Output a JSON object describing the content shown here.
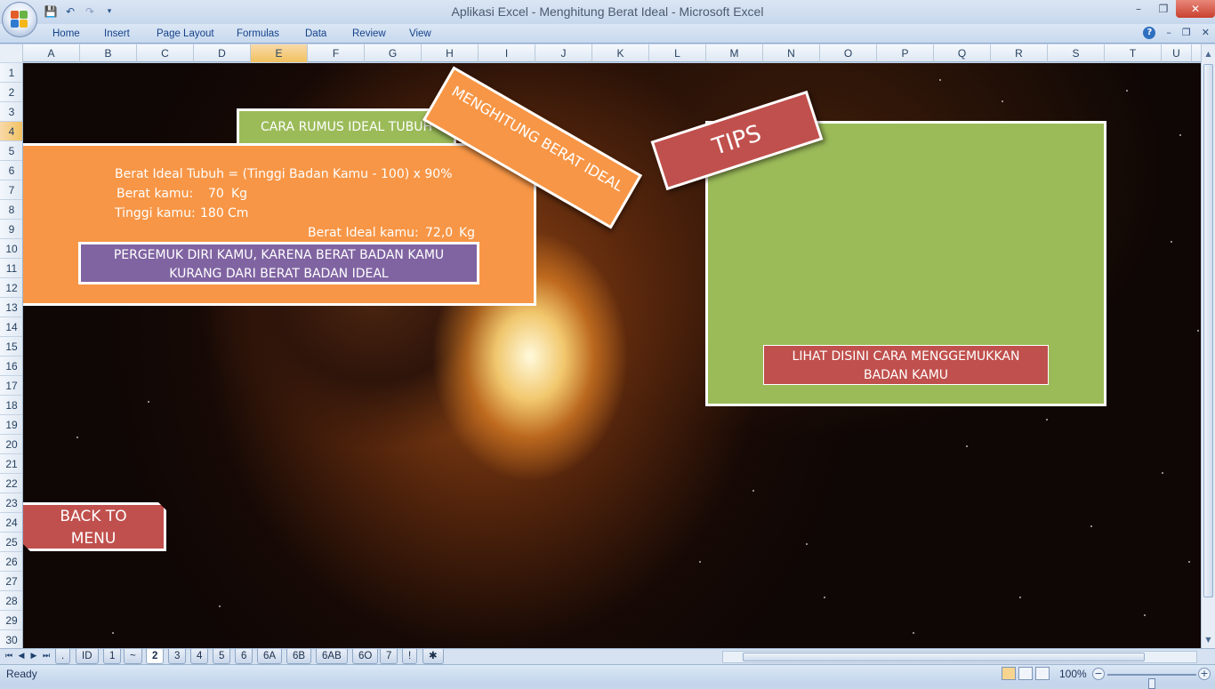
{
  "window": {
    "title": "Aplikasi Excel - Menghitung Berat Ideal - Microsoft Excel"
  },
  "ribbon": {
    "tabs": [
      "Home",
      "Insert",
      "Page Layout",
      "Formulas",
      "Data",
      "Review",
      "View"
    ]
  },
  "grid": {
    "columns": [
      "A",
      "B",
      "C",
      "D",
      "E",
      "F",
      "G",
      "H",
      "I",
      "J",
      "K",
      "L",
      "M",
      "N",
      "O",
      "P",
      "Q",
      "R",
      "S",
      "T",
      "U"
    ],
    "selected_column": "E",
    "rows": [
      "1",
      "2",
      "3",
      "4",
      "5",
      "6",
      "7",
      "8",
      "9",
      "10",
      "11",
      "12",
      "13",
      "14",
      "15",
      "16",
      "17",
      "18",
      "19",
      "20",
      "21",
      "22",
      "23",
      "24",
      "25",
      "26",
      "27",
      "28",
      "29",
      "30"
    ],
    "selected_row": "4"
  },
  "sheet": {
    "title_tag": "CARA RUMUS IDEAL TUBUH",
    "banner": "MENGHITUNG BERAT IDEAL",
    "formula": "Berat Ideal Tubuh = (Tinggi Badan Kamu - 100) x 90%",
    "weight_label": "Berat kamu:",
    "weight_value": "70",
    "weight_unit": "Kg",
    "height_label": "Tinggi kamu:",
    "height_value": "180",
    "height_unit": "Cm",
    "ideal_label": "Berat Ideal kamu:",
    "ideal_value": "72,0",
    "ideal_unit": "Kg",
    "warning_line1": "PERGEMUK DIRI KAMU, KARENA BERAT BADAN KAMU",
    "warning_line2": "KURANG DARI BERAT BADAN IDEAL",
    "tips_banner": "TIPS",
    "tips_link_line1": "LIHAT DISINI CARA MENGGEMUKKAN",
    "tips_link_line2": "BADAN KAMU",
    "back_line1": "BACK TO",
    "back_line2": "MENU"
  },
  "sheet_tabs": {
    "items": [
      ".",
      "ID",
      "1",
      "~",
      "2",
      "3",
      "4",
      "5",
      "6",
      "6A",
      "6B",
      "6AB",
      "6O",
      "7",
      "!"
    ],
    "active": "2"
  },
  "status": {
    "ready": "Ready",
    "zoom": "100%",
    "zoom_level": 1.0
  },
  "colors": {
    "orange": "#f79646",
    "green": "#9bbb59",
    "red": "#c0504d",
    "purple": "#8064a2"
  },
  "icons": [
    "office-button-icon",
    "save-icon",
    "undo-icon",
    "redo-icon",
    "help-icon",
    "minimize-icon",
    "maximize-icon",
    "close-icon"
  ]
}
